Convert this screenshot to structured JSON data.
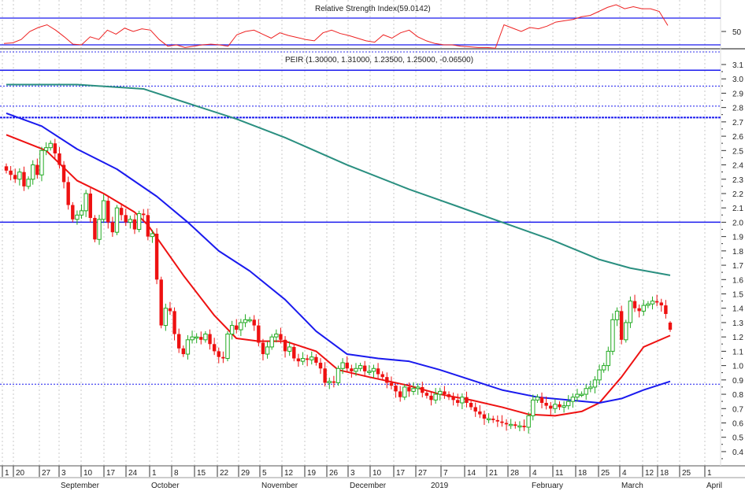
{
  "colors": {
    "up": "#22aa22",
    "down": "#ee1111",
    "ma_short": "#ee1111",
    "ma_mid": "#1a1aee",
    "ma_long": "#2a8f80",
    "level": "#1a1aee",
    "rsi": "#ee2222"
  },
  "chart_data": [
    {
      "type": "line",
      "title": "Relative Strength Index(59.0142)",
      "series": [
        {
          "name": "RSI",
          "values": [
            32,
            33,
            38,
            50,
            56,
            60,
            52,
            42,
            31,
            30,
            42,
            38,
            52,
            46,
            55,
            50,
            54,
            52,
            38,
            28,
            30,
            26,
            28,
            30,
            31,
            30,
            28,
            45,
            50,
            52,
            46,
            40,
            48,
            44,
            41,
            38,
            36,
            48,
            52,
            47,
            44,
            40,
            36,
            34,
            45,
            40,
            48,
            52,
            42,
            36,
            32,
            30,
            30,
            28,
            27,
            26,
            26,
            25,
            60,
            55,
            50,
            56,
            54,
            58,
            64,
            66,
            68,
            72,
            74,
            80,
            86,
            90,
            84,
            87,
            84,
            84,
            80,
            59
          ]
        }
      ],
      "reference_lines": [
        70,
        30
      ],
      "y_tick_labels": [
        "50"
      ],
      "ylim": [
        0,
        100
      ]
    },
    {
      "type": "candlestick",
      "title": "PEIR (1.30000, 1.31000, 1.23500, 1.25000, -0.06500)",
      "last_ohlc": {
        "open": 1.3,
        "high": 1.31,
        "low": 1.235,
        "close": 1.25
      },
      "closes": [
        2.36,
        2.33,
        2.3,
        2.35,
        2.25,
        2.3,
        2.4,
        2.33,
        2.5,
        2.52,
        2.55,
        2.48,
        2.4,
        2.28,
        2.12,
        2.02,
        2.05,
        2.08,
        2.2,
        2.03,
        1.88,
        2.02,
        2.15,
        2.0,
        1.93,
        2.1,
        2.05,
        2.0,
        2.02,
        1.95,
        2.06,
        2.05,
        1.9,
        1.92,
        1.6,
        1.28,
        1.4,
        1.38,
        1.22,
        1.12,
        1.08,
        1.18,
        1.2,
        1.2,
        1.18,
        1.22,
        1.15,
        1.1,
        1.06,
        1.05,
        1.22,
        1.28,
        1.25,
        1.3,
        1.32,
        1.32,
        1.28,
        1.16,
        1.08,
        1.13,
        1.2,
        1.22,
        1.18,
        1.1,
        1.13,
        1.05,
        1.03,
        1.05,
        1.04,
        1.06,
        1.02,
        0.98,
        0.88,
        0.89,
        0.88,
        0.98,
        1.02,
        0.98,
        0.96,
        0.98,
        1.0,
        0.96,
        0.96,
        0.98,
        0.94,
        0.92,
        0.88,
        0.86,
        0.82,
        0.78,
        0.85,
        0.82,
        0.84,
        0.85,
        0.81,
        0.79,
        0.76,
        0.8,
        0.82,
        0.8,
        0.78,
        0.76,
        0.74,
        0.78,
        0.74,
        0.71,
        0.68,
        0.66,
        0.63,
        0.63,
        0.62,
        0.61,
        0.6,
        0.59,
        0.59,
        0.58,
        0.58,
        0.57,
        0.65,
        0.76,
        0.78,
        0.74,
        0.72,
        0.7,
        0.73,
        0.71,
        0.72,
        0.75,
        0.78,
        0.8,
        0.8,
        0.84,
        0.85,
        0.9,
        0.97,
        1.0,
        1.1,
        1.32,
        1.38,
        1.18,
        1.3,
        1.45,
        1.4,
        1.38,
        1.42,
        1.43,
        1.45,
        1.44,
        1.42,
        1.36,
        1.3
      ],
      "moving_averages": [
        {
          "name": "MA short",
          "points": [
            [
              0,
              2.61
            ],
            [
              9,
              2.5
            ],
            [
              16,
              2.29
            ],
            [
              22,
              2.2
            ],
            [
              29,
              2.07
            ],
            [
              32,
              1.98
            ],
            [
              40,
              1.63
            ],
            [
              47,
              1.35
            ],
            [
              52,
              1.19
            ],
            [
              57,
              1.17
            ],
            [
              63,
              1.17
            ],
            [
              70,
              1.1
            ],
            [
              75,
              0.97
            ],
            [
              82,
              0.92
            ],
            [
              91,
              0.86
            ],
            [
              98,
              0.8
            ],
            [
              105,
              0.76
            ],
            [
              112,
              0.71
            ],
            [
              118,
              0.66
            ],
            [
              124,
              0.65
            ],
            [
              130,
              0.68
            ],
            [
              134,
              0.74
            ],
            [
              139,
              0.92
            ],
            [
              144,
              1.13
            ],
            [
              150,
              1.21
            ]
          ]
        },
        {
          "name": "MA mid",
          "points": [
            [
              0,
              2.76
            ],
            [
              8,
              2.67
            ],
            [
              16,
              2.51
            ],
            [
              25,
              2.37
            ],
            [
              34,
              2.18
            ],
            [
              41,
              2.0
            ],
            [
              48,
              1.8
            ],
            [
              55,
              1.66
            ],
            [
              63,
              1.46
            ],
            [
              70,
              1.24
            ],
            [
              77,
              1.08
            ],
            [
              84,
              1.05
            ],
            [
              91,
              1.03
            ],
            [
              98,
              0.97
            ],
            [
              105,
              0.9
            ],
            [
              112,
              0.83
            ],
            [
              120,
              0.78
            ],
            [
              127,
              0.76
            ],
            [
              134,
              0.74
            ],
            [
              139,
              0.77
            ],
            [
              144,
              0.83
            ],
            [
              150,
              0.89
            ]
          ]
        },
        {
          "name": "MA long",
          "points": [
            [
              0,
              2.96
            ],
            [
              16,
              2.96
            ],
            [
              31,
              2.93
            ],
            [
              40,
              2.84
            ],
            [
              52,
              2.72
            ],
            [
              63,
              2.59
            ],
            [
              77,
              2.4
            ],
            [
              91,
              2.23
            ],
            [
              102,
              2.11
            ],
            [
              112,
              2.0
            ],
            [
              123,
              1.88
            ],
            [
              134,
              1.74
            ],
            [
              141,
              1.68
            ],
            [
              150,
              1.63
            ]
          ]
        }
      ],
      "levels": [
        {
          "value": 3.06,
          "style": "solid"
        },
        {
          "value": 2.95,
          "style": "dotted"
        },
        {
          "value": 2.81,
          "style": "dotted"
        },
        {
          "value": 2.73,
          "style": "dashed"
        },
        {
          "value": 2.0,
          "style": "solid"
        },
        {
          "value": 0.87,
          "style": "dotted"
        }
      ],
      "ylim": [
        0.4,
        3.1
      ],
      "y_tick_labels": [
        "3.1",
        "3.0",
        "2.9",
        "2.8",
        "2.7",
        "2.6",
        "2.5",
        "2.4",
        "2.3",
        "2.2",
        "2.1",
        "2.0",
        "1.9",
        "1.8",
        "1.7",
        "1.6",
        "1.5",
        "1.4",
        "1.3",
        "1.2",
        "1.1",
        "1.0",
        "0.9",
        "0.8",
        "0.7",
        "0.6",
        "0.5",
        "0.4"
      ],
      "x_tick_labels": [
        "1",
        "20",
        "27",
        "3",
        "10",
        "17",
        "24",
        "1",
        "8",
        "15",
        "22",
        "29",
        "5",
        "12",
        "19",
        "26",
        "3",
        "10",
        "17",
        "27",
        "7",
        "14",
        "21",
        "28",
        "4",
        "11",
        "18",
        "25",
        "4",
        "12",
        "18",
        "25",
        "1"
      ],
      "month_labels": [
        "September",
        "October",
        "November",
        "December",
        "2019",
        "February",
        "March",
        "April"
      ]
    }
  ]
}
